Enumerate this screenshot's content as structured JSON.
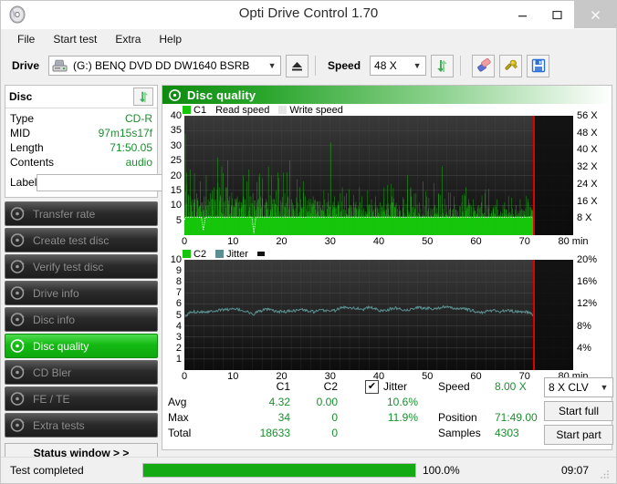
{
  "window": {
    "title": "Opti Drive Control 1.70",
    "icon": "disc-icon",
    "minimize": "–",
    "maximize": "☐",
    "close": "✕"
  },
  "menu": [
    "File",
    "Start test",
    "Extra",
    "Help"
  ],
  "toolbar": {
    "drive_label": "Drive",
    "drive_value": "(G:)   BENQ DVD DD DW1640 BSRB",
    "eject_title": "Eject",
    "speed_label": "Speed",
    "speed_value": "48 X",
    "refresh_icon": "refresh-arrows-icon",
    "erase_icon": "eraser-icon",
    "tools_icon": "tools-icon",
    "save_icon": "save-floppy-icon"
  },
  "disc": {
    "header": "Disc",
    "refresh_icon": "refresh-arrows-icon",
    "rows": [
      {
        "key": "Type",
        "value": "CD-R"
      },
      {
        "key": "MID",
        "value": "97m15s17f"
      },
      {
        "key": "Length",
        "value": "71:50.05"
      },
      {
        "key": "Contents",
        "value": "audio"
      }
    ],
    "label_key": "Label",
    "label_value": "",
    "label_placeholder": "",
    "cd_icon": "cd-disc-icon"
  },
  "nav": {
    "items": [
      {
        "label": "Transfer rate",
        "icon": "disc-icon",
        "active": false
      },
      {
        "label": "Create test disc",
        "icon": "disc-icon",
        "active": false
      },
      {
        "label": "Verify test disc",
        "icon": "disc-icon",
        "active": false
      },
      {
        "label": "Drive info",
        "icon": "disc-icon",
        "active": false
      },
      {
        "label": "Disc info",
        "icon": "disc-icon",
        "active": false
      },
      {
        "label": "Disc quality",
        "icon": "disc-icon",
        "active": true
      },
      {
        "label": "CD Bler",
        "icon": "disc-icon",
        "active": false
      },
      {
        "label": "FE / TE",
        "icon": "disc-icon",
        "active": false
      },
      {
        "label": "Extra tests",
        "icon": "disc-icon",
        "active": false
      }
    ],
    "status_window": "Status window > >"
  },
  "panel": {
    "title": "Disc quality",
    "icon": "disc-icon"
  },
  "stats": {
    "col_c1": "C1",
    "col_c2": "C2",
    "jitter_label": "Jitter",
    "jitter_checked": true,
    "rows": [
      {
        "name": "Avg",
        "c1": "4.32",
        "c2": "0.00",
        "jitter": "10.6%"
      },
      {
        "name": "Max",
        "c1": "34",
        "c2": "0",
        "jitter": "11.9%"
      },
      {
        "name": "Total",
        "c1": "18633",
        "c2": "0",
        "jitter": ""
      }
    ],
    "speed_label": "Speed",
    "speed_value": "8.00 X",
    "position_label": "Position",
    "position_value": "71:49.00",
    "samples_label": "Samples",
    "samples_value": "4303",
    "mode_value": "8 X CLV",
    "start_full": "Start full",
    "start_part": "Start part"
  },
  "statusbar": {
    "text": "Test completed",
    "percent": "100.0%",
    "progress": 100,
    "time": "09:07"
  },
  "colors": {
    "c1_green": "#16c60c",
    "jitter_teal": "#5b8f8f",
    "read_speed_white": "#ffffff",
    "marker_red": "#e00000",
    "value_green": "#1a8f2e",
    "active_nav": "#13b913"
  },
  "chart_data": [
    {
      "type": "area",
      "id": "c1-chart",
      "title": "C1 / Read speed",
      "xlabel": "min",
      "ylabel": "C1",
      "y2label": "X",
      "xlim": [
        0,
        80
      ],
      "ylim": [
        0,
        40
      ],
      "y2lim": [
        0,
        56
      ],
      "xticks": [
        0,
        10,
        20,
        30,
        40,
        50,
        60,
        70,
        80
      ],
      "yticks": [
        5,
        10,
        15,
        20,
        25,
        30,
        35,
        40
      ],
      "y2ticks": [
        "8 X",
        "16 X",
        "24 X",
        "32 X",
        "40 X",
        "48 X",
        "56 X"
      ],
      "grid": true,
      "legend": [
        "C1",
        "Read speed",
        "Write speed"
      ],
      "legend_position": "top-left",
      "data_end_x": 71.8,
      "marker_x": 71.8,
      "series": [
        {
          "name": "C1",
          "color": "#16c60c",
          "x": [
            0.2,
            0.5,
            0.9,
            1.3,
            1.7,
            2.1,
            2.5,
            2.9,
            3.3,
            3.7,
            4.1,
            4.5,
            4.9,
            5.3,
            5.7,
            6.1,
            6.5,
            6.9,
            7.3,
            7.7,
            8.1,
            8.5,
            8.9,
            9.3,
            9.7,
            10.1,
            10.5,
            10.9,
            11.3,
            11.7,
            12.1,
            12.5,
            12.9,
            13.3,
            13.7,
            14.1,
            14.5,
            14.9,
            15.3,
            15.7,
            16.1,
            16.5,
            16.9,
            17.3,
            17.7,
            18.1,
            18.5,
            18.9,
            19.3,
            19.7,
            20.1,
            20.5,
            20.9,
            21.3,
            21.7,
            22.1,
            22.5,
            22.9,
            23.3,
            23.7,
            24.1,
            24.5,
            24.9,
            25.3,
            25.7,
            26.1,
            26.5,
            26.9,
            27.3,
            27.7,
            28.1,
            28.5,
            28.9,
            29.3,
            29.7,
            30.1,
            30.5,
            30.9,
            31.3,
            31.7,
            32.1,
            32.5,
            32.9,
            33.3,
            33.7,
            34.1,
            34.5,
            34.9,
            35.3,
            35.7,
            36.1,
            36.5,
            36.9,
            37.3,
            37.7,
            38.1,
            38.5,
            38.9,
            39.3,
            39.7,
            40.3,
            41.1,
            41.9,
            42.7,
            43.5,
            44.3,
            45.1,
            45.9,
            46.7,
            47.5,
            48.3,
            49.1,
            49.9,
            50.7,
            51.5,
            52.3,
            53.1,
            53.9,
            54.7,
            55.5,
            56.3,
            57.1,
            57.9,
            58.7,
            59.5,
            60.3,
            61.1,
            61.9,
            62.7,
            63.5,
            64.3,
            65.1,
            65.9,
            66.7,
            67.5,
            68.3,
            69.1,
            69.9,
            70.7,
            71.5
          ],
          "values": [
            34,
            17,
            13,
            13,
            12,
            12,
            14,
            9,
            18,
            11,
            13,
            20,
            12,
            14,
            15,
            16,
            12,
            26,
            16,
            23,
            11,
            16,
            25,
            13,
            10,
            9,
            11,
            13,
            9,
            11,
            20,
            12,
            18,
            22,
            13,
            14,
            8,
            11,
            9,
            13,
            12,
            10,
            11,
            23,
            8,
            9,
            12,
            15,
            21,
            8,
            11,
            7,
            9,
            13,
            25,
            12,
            10,
            9,
            11,
            16,
            9,
            18,
            13,
            10,
            8,
            9,
            13,
            12,
            8,
            10,
            9,
            10,
            12,
            11,
            10,
            31,
            10,
            13,
            9,
            11,
            14,
            16,
            13,
            14,
            9,
            10,
            8,
            11,
            9,
            8,
            11,
            13,
            9,
            8,
            10,
            9,
            12,
            8,
            13,
            9,
            11,
            16,
            9,
            13,
            10,
            8,
            12,
            20,
            13,
            9,
            11,
            18,
            13,
            9,
            10,
            14,
            23,
            10,
            9,
            13,
            8,
            11,
            16,
            10,
            12,
            9,
            11,
            14,
            10,
            9,
            12,
            8,
            11,
            13,
            9,
            10,
            12,
            8,
            11,
            9,
            13
          ]
        },
        {
          "name": "Read speed",
          "color": "#ffffff",
          "constant": 6.0,
          "note": "flat white dashed line at ~8X (plots near y=6 on C1 scale); two brief drops near x=3.8 and x=14.3"
        }
      ]
    },
    {
      "type": "line",
      "id": "jitter-chart",
      "title": "C2 / Jitter",
      "xlabel": "min",
      "ylabel": "C2",
      "y2label": "%",
      "xlim": [
        0,
        80
      ],
      "ylim": [
        0,
        10
      ],
      "y2lim": [
        0,
        20
      ],
      "xticks": [
        0,
        10,
        20,
        30,
        40,
        50,
        60,
        70,
        80
      ],
      "yticks": [
        1,
        2,
        3,
        4,
        5,
        6,
        7,
        8,
        9,
        10
      ],
      "y2ticks": [
        "4%",
        "8%",
        "12%",
        "16%",
        "20%"
      ],
      "grid": true,
      "legend": [
        "C2",
        "Jitter"
      ],
      "legend_position": "top-left",
      "data_end_x": 71.8,
      "marker_x": 71.8,
      "series": [
        {
          "name": "C2",
          "color": "#16c60c",
          "values": [
            0
          ]
        },
        {
          "name": "Jitter",
          "color": "#5b8f8f",
          "x": [
            0.2,
            1,
            2,
            3,
            4,
            5,
            6,
            7,
            8,
            9,
            10,
            11,
            12,
            13,
            14,
            15,
            16,
            17,
            18,
            19,
            20,
            21,
            22,
            23,
            24,
            25,
            26,
            27,
            28,
            29,
            30,
            31,
            32,
            33,
            34,
            35,
            36,
            37,
            38,
            39,
            40,
            41,
            42,
            43,
            44,
            45,
            46,
            47,
            48,
            49,
            50,
            51,
            52,
            53,
            54,
            55,
            56,
            57,
            58,
            59,
            60,
            61,
            62,
            63,
            64,
            65,
            66,
            67,
            68,
            69,
            70,
            71,
            71.8
          ],
          "values": [
            4.8,
            5.2,
            5.3,
            5.3,
            5.3,
            5.3,
            5.4,
            5.4,
            5.5,
            5.5,
            5.5,
            5.5,
            5.4,
            5.3,
            5.0,
            5.3,
            5.4,
            5.5,
            5.4,
            5.3,
            5.3,
            5.3,
            5.4,
            5.4,
            5.5,
            5.4,
            5.3,
            5.3,
            5.4,
            5.4,
            5.4,
            5.4,
            5.6,
            5.7,
            5.7,
            5.6,
            5.6,
            5.5,
            5.7,
            5.6,
            5.4,
            5.4,
            5.5,
            5.6,
            5.6,
            5.5,
            5.4,
            5.6,
            5.7,
            5.6,
            5.6,
            5.6,
            5.6,
            5.7,
            5.7,
            5.6,
            5.6,
            5.6,
            5.5,
            5.4,
            5.3,
            5.2,
            5.3,
            5.4,
            5.4,
            5.3,
            5.4,
            5.4,
            5.3,
            5.3,
            5.3,
            5.2,
            4.9
          ],
          "unit": "%",
          "note": "plotted against right axis where 5.3 on left scale corresponds to ~10.6%"
        }
      ]
    }
  ]
}
